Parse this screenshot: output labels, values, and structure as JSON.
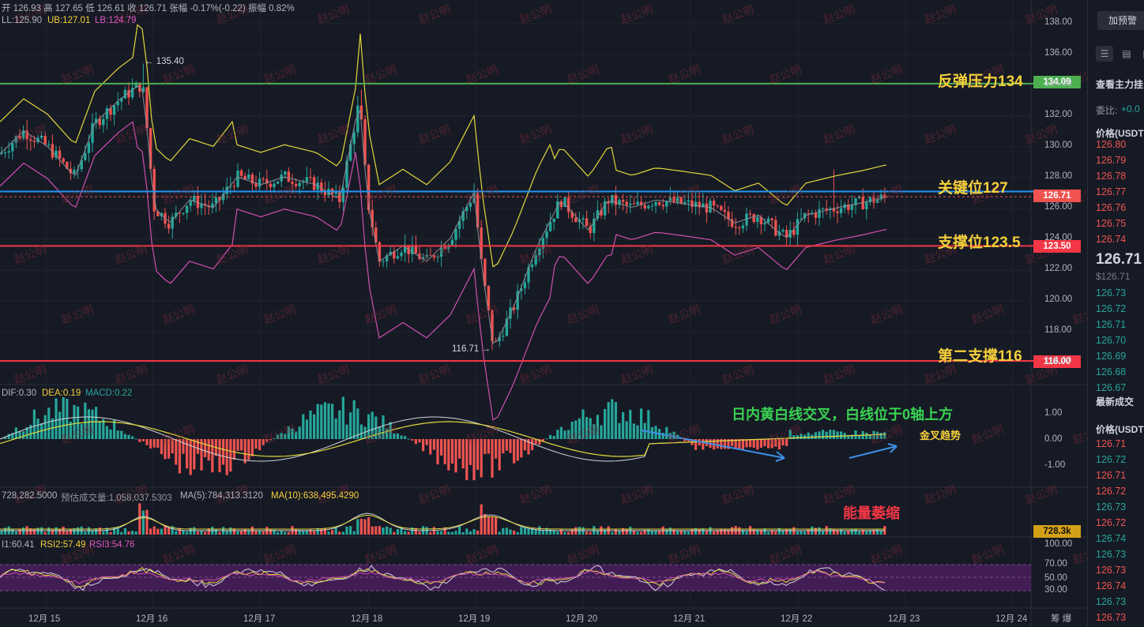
{
  "header": {
    "ohlc": "开 126.93  高 127.65  低 126.61  收 126.71  张幅 -0.17%(-0.22)  振幅 0.82%",
    "boll_mid": "LL:125.90",
    "boll_ub": "UB:127.01",
    "boll_lb": "LB:124.79"
  },
  "annotations": {
    "high_label": "← 135.40",
    "low_label": "116.71 →",
    "resistance": "反弹压力134",
    "key_level": "关键位127",
    "support": "支撑位123.5",
    "second_support": "第二支撑116",
    "macd_note": "日内黄白线交叉，白线位于0轴上方",
    "golden_cross": "金叉趋势",
    "volume_note": "能量萎缩",
    "watermark": "赵公明"
  },
  "price_tags": {
    "resistance": "134.09",
    "current": "126.71",
    "support": "123.50",
    "second_support": "116.00",
    "volume": "728.3k"
  },
  "price_axis": [
    "138.00",
    "136.00",
    "134.00",
    "132.00",
    "130.00",
    "128.00",
    "126.00",
    "124.00",
    "122.00",
    "120.00",
    "118.00",
    "116.00"
  ],
  "macd": {
    "dif": "DIF:0.30",
    "dea": "DEA:0.19",
    "macd": "MACD:0.22",
    "ticks": [
      "1.00",
      "0.00",
      "-1.00"
    ]
  },
  "volume": {
    "vol": "728,282.5000",
    "est": "预估成交量:1,058,037.5303",
    "ma5": "MA(5):784,313.3120",
    "ma10": "MA(10):638,495.4290"
  },
  "rsi": {
    "rsi1": "I1:60.41",
    "rsi2": "RSI2:57.49",
    "rsi3": "RSI3:54.76",
    "ticks": [
      "100.00",
      "70.00",
      "50.00",
      "30.00"
    ]
  },
  "dates": [
    "12月 15",
    "12月 16",
    "12月 17",
    "12月 18",
    "12月 19",
    "12月 20",
    "12月 21",
    "12月 22",
    "12月 23",
    "12月 24"
  ],
  "corner_label": "筹 爆",
  "panel": {
    "add_button": "加预警",
    "order_book_title": "查看主力挂",
    "ratio_label": "委比:",
    "ratio_value": "+0.0",
    "price_header": "价格(USDT",
    "asks": [
      "126.80",
      "126.79",
      "126.78",
      "126.77",
      "126.76",
      "126.75",
      "126.74"
    ],
    "last_price": "126.71",
    "last_price_usd": "$126.71",
    "bids": [
      "126.73",
      "126.72",
      "126.71",
      "126.70",
      "126.69",
      "126.68",
      "126.67"
    ],
    "trades_title": "最新成交",
    "trades_header": "价格(USDT",
    "trades": [
      "126.71",
      "126.72",
      "126.71",
      "126.72",
      "126.73",
      "126.72",
      "126.74",
      "126.73",
      "126.73",
      "126.74",
      "126.73",
      "126.73"
    ],
    "colors": {
      "up": "#26a69a",
      "down": "#ef5350"
    }
  },
  "colors": {
    "up": "#26a69a",
    "down": "#ef5350",
    "resistance_line": "#4caf50",
    "key_line": "#2196f3",
    "support_line": "#f23645",
    "label_yellow": "#f5d03b",
    "macd_note_green": "#39d353"
  }
}
